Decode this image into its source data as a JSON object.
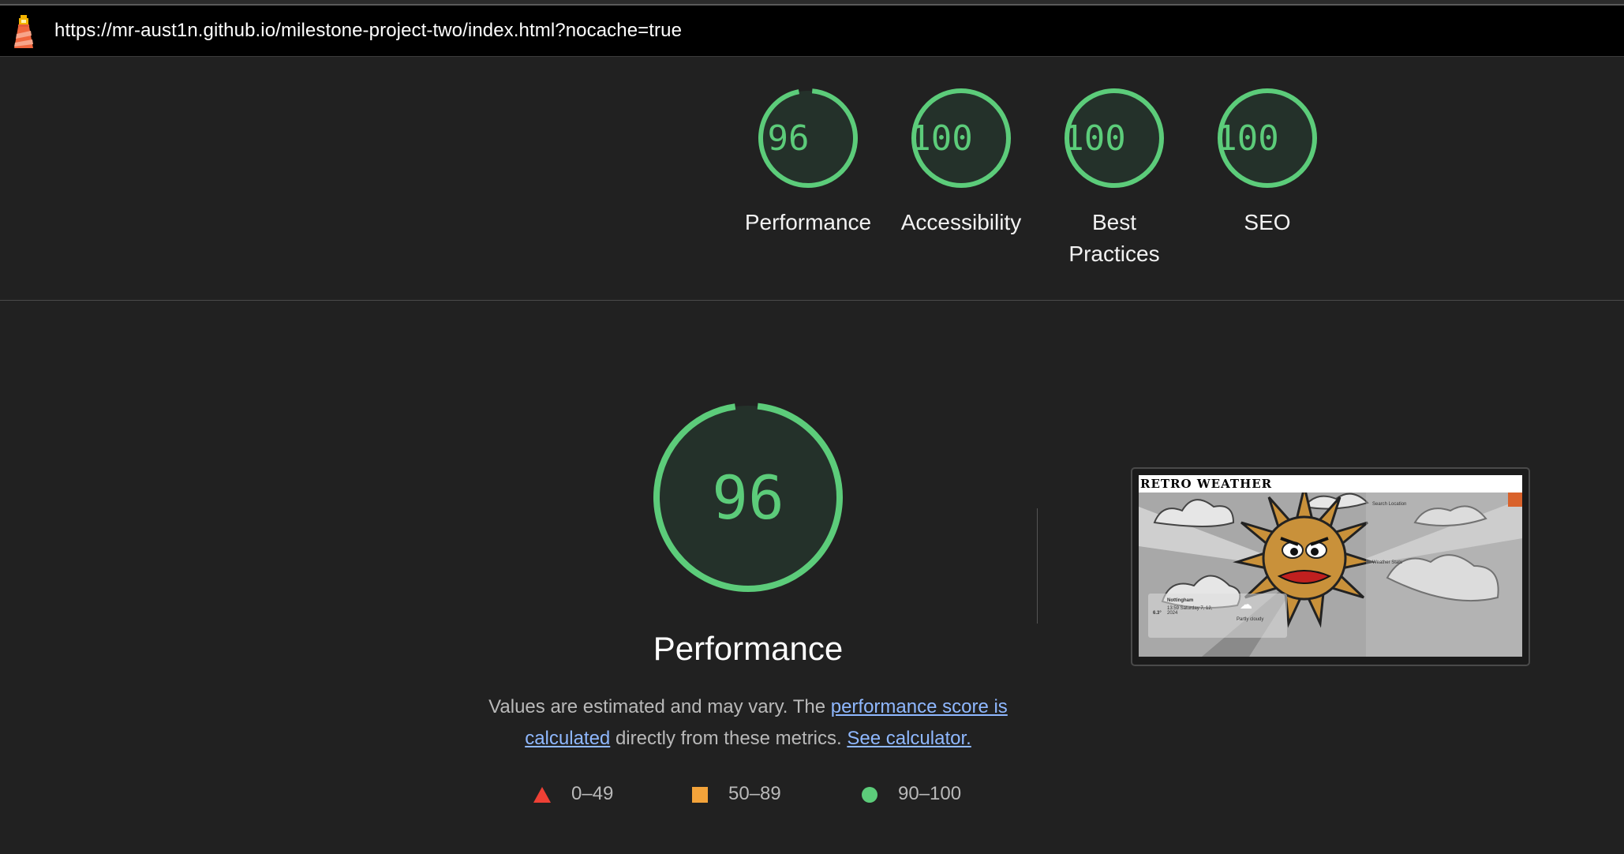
{
  "url_bar": {
    "url": "https://mr-aust1n.github.io/milestone-project-two/index.html?nocache=true",
    "logo_icon": "lighthouse-icon"
  },
  "summary": {
    "gauges": [
      {
        "score": "96",
        "label": "Performance"
      },
      {
        "score": "100",
        "label": "Accessibility"
      },
      {
        "score": "100",
        "label": "Best Practices"
      },
      {
        "score": "100",
        "label": "SEO"
      }
    ]
  },
  "performance": {
    "score": "96",
    "score_value": 0.96,
    "title": "Performance",
    "desc_prefix": "Values are estimated and may vary. The ",
    "desc_link": "performance score is calculated",
    "desc_middle": " directly from these metrics. ",
    "desc_link2": "See calculator."
  },
  "legend": [
    {
      "shape": "triangle",
      "range": "0–49",
      "color": "#ee4035"
    },
    {
      "shape": "square",
      "range": "50–89",
      "color": "#f3a33a"
    },
    {
      "shape": "circle",
      "range": "90–100",
      "color": "#5ccc7a"
    }
  ],
  "thumbnail": {
    "site_title": "RETRO WEATHER",
    "search_label": "Search Location",
    "weather_label": "Weather Stats",
    "city": "Nottingham",
    "date": "13:59 Saturday 7, 12, 2024",
    "temp": "6.3°",
    "condition": "Partly cloudy"
  },
  "colors": {
    "pass": "#5ccc7a",
    "pass_bg": "#24312a",
    "background": "#212121"
  }
}
